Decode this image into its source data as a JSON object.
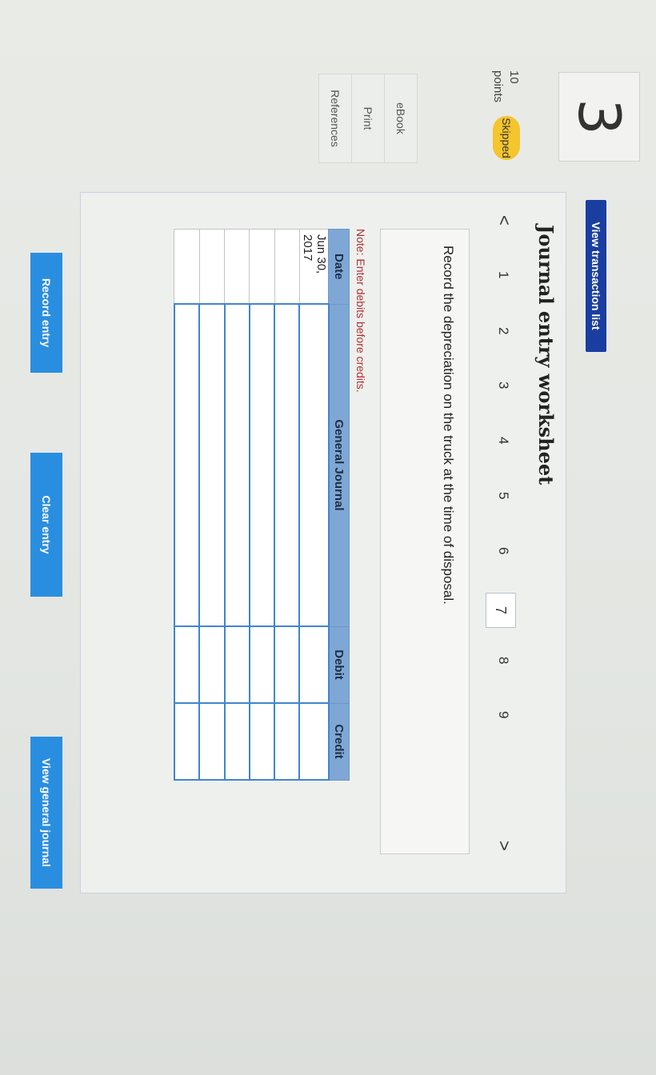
{
  "question": {
    "number": "3",
    "points_value": "10",
    "points_label": "points",
    "status": "Skipped"
  },
  "side_links": [
    "eBook",
    "Print",
    "References"
  ],
  "toolbar": {
    "view_transaction_list": "View transaction list"
  },
  "worksheet": {
    "title": "Journal entry worksheet",
    "pager": {
      "prev": "<",
      "pages": [
        "1",
        "2",
        "3",
        "4",
        "5",
        "6",
        "7",
        "8",
        "9"
      ],
      "current": "7",
      "next": ">"
    },
    "instruction": "Record the depreciation on the truck at the time of disposal.",
    "note": "Note: Enter debits before credits.",
    "table": {
      "headers": [
        "Date",
        "General Journal",
        "Debit",
        "Credit"
      ],
      "rows": [
        {
          "date": "Jun 30, 2017",
          "account": "",
          "debit": "",
          "credit": ""
        },
        {
          "date": "",
          "account": "",
          "debit": "",
          "credit": ""
        },
        {
          "date": "",
          "account": "",
          "debit": "",
          "credit": ""
        },
        {
          "date": "",
          "account": "",
          "debit": "",
          "credit": ""
        },
        {
          "date": "",
          "account": "",
          "debit": "",
          "credit": ""
        },
        {
          "date": "",
          "account": "",
          "debit": "",
          "credit": ""
        }
      ]
    }
  },
  "actions": {
    "record_entry": "Record entry",
    "clear_entry": "Clear entry",
    "view_general_journal": "View general journal"
  },
  "colors": {
    "header": "#7ea7d6",
    "button": "#2a8ee0",
    "nav": "#1a3ea0",
    "skipped": "#f4c52c"
  }
}
